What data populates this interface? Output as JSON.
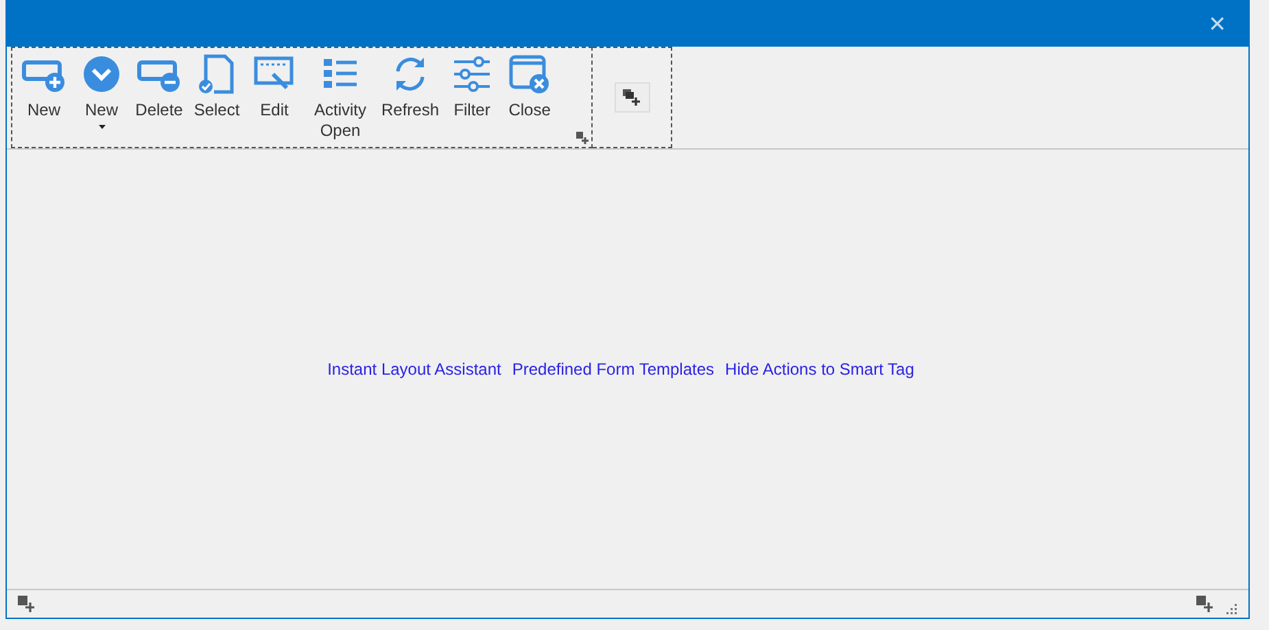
{
  "window": {
    "close_glyph": "✕"
  },
  "toolbar": {
    "buttons": [
      {
        "label": "New",
        "dropdown": false
      },
      {
        "label": "New",
        "dropdown": true
      },
      {
        "label": "Delete",
        "dropdown": false
      },
      {
        "label": "Select",
        "dropdown": false
      },
      {
        "label": "Edit",
        "dropdown": false
      },
      {
        "label": "Activity Open",
        "dropdown": false
      },
      {
        "label": "Refresh",
        "dropdown": false
      },
      {
        "label": "Filter",
        "dropdown": false
      },
      {
        "label": "Close",
        "dropdown": false
      }
    ]
  },
  "links": [
    "Instant Layout Assistant",
    "Predefined Form Templates",
    "Hide Actions to Smart Tag"
  ]
}
